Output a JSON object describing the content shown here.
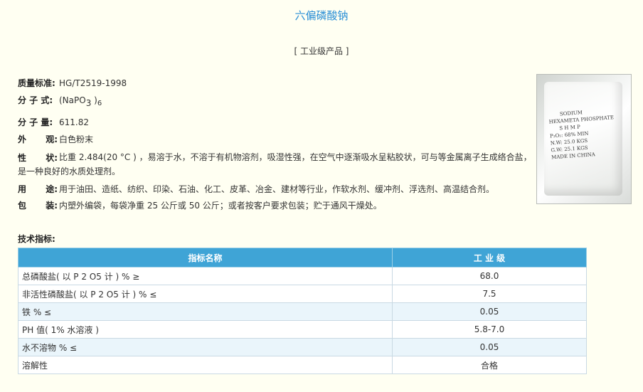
{
  "title": "六偏磷酸钠",
  "subtitle": "[ 工业级产品 ]",
  "specs": {
    "standard": {
      "label": "质量标准:",
      "value": "HG/T2519-1998"
    },
    "formula": {
      "label": "分 子 式:",
      "prefix": "(NaPO",
      "sub3": "3",
      "mid": " )",
      "sub6": "6"
    },
    "weight": {
      "label": "分 子 量:",
      "value": "611.82"
    },
    "appearance": {
      "label_a": "外",
      "label_b": "观:",
      "value": "白色粉末"
    },
    "property": {
      "label_a": "性",
      "label_b": "状:",
      "value": "比重 2.484(20 °C ) ，易溶于水，不溶于有机物溶剂，吸湿性强，在空气中逐渐吸水呈粘胶状，可与等金属离子生成络合盐，是一种良好的水质处理剂。"
    },
    "usage": {
      "label_a": "用",
      "label_b": "途:",
      "value": "用于油田、造纸、纺织、印染、石油、化工、皮革、冶金、建材等行业，作软水剂、缓冲剂、浮选剂、高温结合剂。"
    },
    "packing": {
      "label_a": "包",
      "label_b": "装:",
      "value": "内塑外编袋，每袋净重 25 公斤或 50 公斤；或者按客户要求包装；贮于通风干燥处。"
    }
  },
  "photo": {
    "lines": [
      "SODIUM",
      "HEXAMETA PHOSPHATE",
      "S H M P",
      "P₂O₅: 68% MIN",
      "N.W: 25.0 KGS",
      "G.W: 25.1 KGS",
      "MADE IN CHINA"
    ]
  },
  "tech": {
    "label": "技术指标:",
    "headers": [
      "指标名称",
      "工 业 级"
    ],
    "rows": [
      {
        "name": "总磷酸盐( 以 P 2 O5 计 ) % ≥",
        "value": "68.0"
      },
      {
        "name": "非活性磷酸盐( 以 P 2 O5 计 ) % ≤",
        "value": "7.5"
      },
      {
        "name": "铁 % ≤",
        "value": "0.05"
      },
      {
        "name": "PH 值( 1% 水溶液 )",
        "value": "5.8-7.0"
      },
      {
        "name": "水不溶物 % ≤",
        "value": "0.05"
      },
      {
        "name": "溶解性",
        "value": "合格"
      }
    ]
  }
}
